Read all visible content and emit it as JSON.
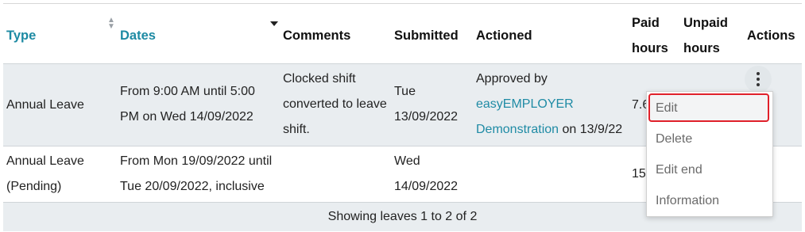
{
  "table": {
    "headers": {
      "type": "Type",
      "dates": "Dates",
      "comments": "Comments",
      "submitted": "Submitted",
      "actioned": "Actioned",
      "paid_line1": "Paid",
      "paid_line2": "hours",
      "unpaid_line1": "Unpaid",
      "unpaid_line2": "hours",
      "actions": "Actions"
    },
    "rows": [
      {
        "type": "Annual Leave",
        "dates_line1": "From 9:00 AM until 5:00",
        "dates_line2": "PM on Wed 14/09/2022",
        "comments_line1": "Clocked shift",
        "comments_line2": "converted to leave",
        "comments_line3": "shift.",
        "submitted_line1": "Tue",
        "submitted_line2": "13/09/2022",
        "actioned_line1": "Approved by",
        "actioned_link1": "easyEMPLOYER",
        "actioned_link2": "Demonstration",
        "actioned_suffix": " on 13/9/22",
        "paid_hours": "7.6"
      },
      {
        "type_line1": "Annual Leave",
        "type_line2": "(Pending)",
        "dates_line1": "From Mon 19/09/2022 until",
        "dates_line2": "Tue 20/09/2022, inclusive",
        "submitted_line1": "Wed",
        "submitted_line2": "14/09/2022",
        "paid_hours": "15"
      }
    ],
    "footer": "Showing leaves 1 to 2 of 2"
  },
  "actions_menu": {
    "items": [
      "Edit",
      "Delete",
      "Edit end",
      "Information"
    ],
    "highlighted": "Edit"
  },
  "colors": {
    "link": "#1f8ba5",
    "highlight_border": "#e0202a",
    "row_bg": "#e9edf0"
  }
}
